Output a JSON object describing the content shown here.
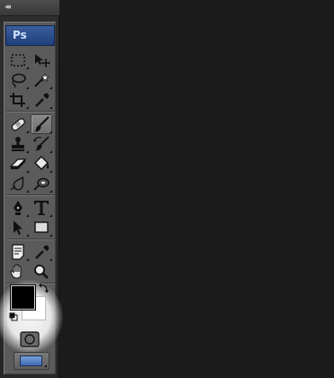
{
  "panel": {
    "collapse_icon": "double-chevron-left-icon",
    "collapse_glyph": "◂◂"
  },
  "toolbox": {
    "logo_text": "Ps",
    "logo_color": "#2b4f8e",
    "tools": [
      {
        "name": "rectangular-marquee",
        "icon": "marquee-icon"
      },
      {
        "name": "move",
        "icon": "move-icon"
      },
      {
        "name": "lasso",
        "icon": "lasso-icon"
      },
      {
        "name": "magic-wand",
        "icon": "magic-wand-icon"
      },
      {
        "name": "crop",
        "icon": "crop-icon"
      },
      {
        "name": "eyedropper",
        "icon": "eyedropper-icon"
      },
      {
        "name": "spot-healing-brush",
        "icon": "bandage-icon"
      },
      {
        "name": "brush",
        "icon": "brush-icon",
        "active": true
      },
      {
        "name": "clone-stamp",
        "icon": "stamp-icon"
      },
      {
        "name": "history-brush",
        "icon": "history-brush-icon"
      },
      {
        "name": "eraser",
        "icon": "eraser-icon"
      },
      {
        "name": "paint-bucket",
        "icon": "paint-bucket-icon"
      },
      {
        "name": "blur",
        "icon": "blur-drop-icon"
      },
      {
        "name": "dodge",
        "icon": "dodge-icon"
      },
      {
        "name": "pen",
        "icon": "pen-icon"
      },
      {
        "name": "type",
        "icon": "type-icon",
        "glyph": "T"
      },
      {
        "name": "path-selection",
        "icon": "arrow-icon"
      },
      {
        "name": "rectangle-shape",
        "icon": "rectangle-icon"
      },
      {
        "name": "notes",
        "icon": "notes-icon"
      },
      {
        "name": "color-sampler",
        "icon": "color-sampler-icon"
      },
      {
        "name": "hand",
        "icon": "hand-icon"
      },
      {
        "name": "zoom",
        "icon": "magnifier-icon"
      }
    ],
    "foreground_color": "#000000",
    "background_color": "#ffffff",
    "swap_icon": "swap-colors-icon",
    "reset_icon": "default-colors-icon",
    "quick_mask_icon": "quick-mask-icon",
    "screen_mode_icon": "screen-mode-icon"
  }
}
